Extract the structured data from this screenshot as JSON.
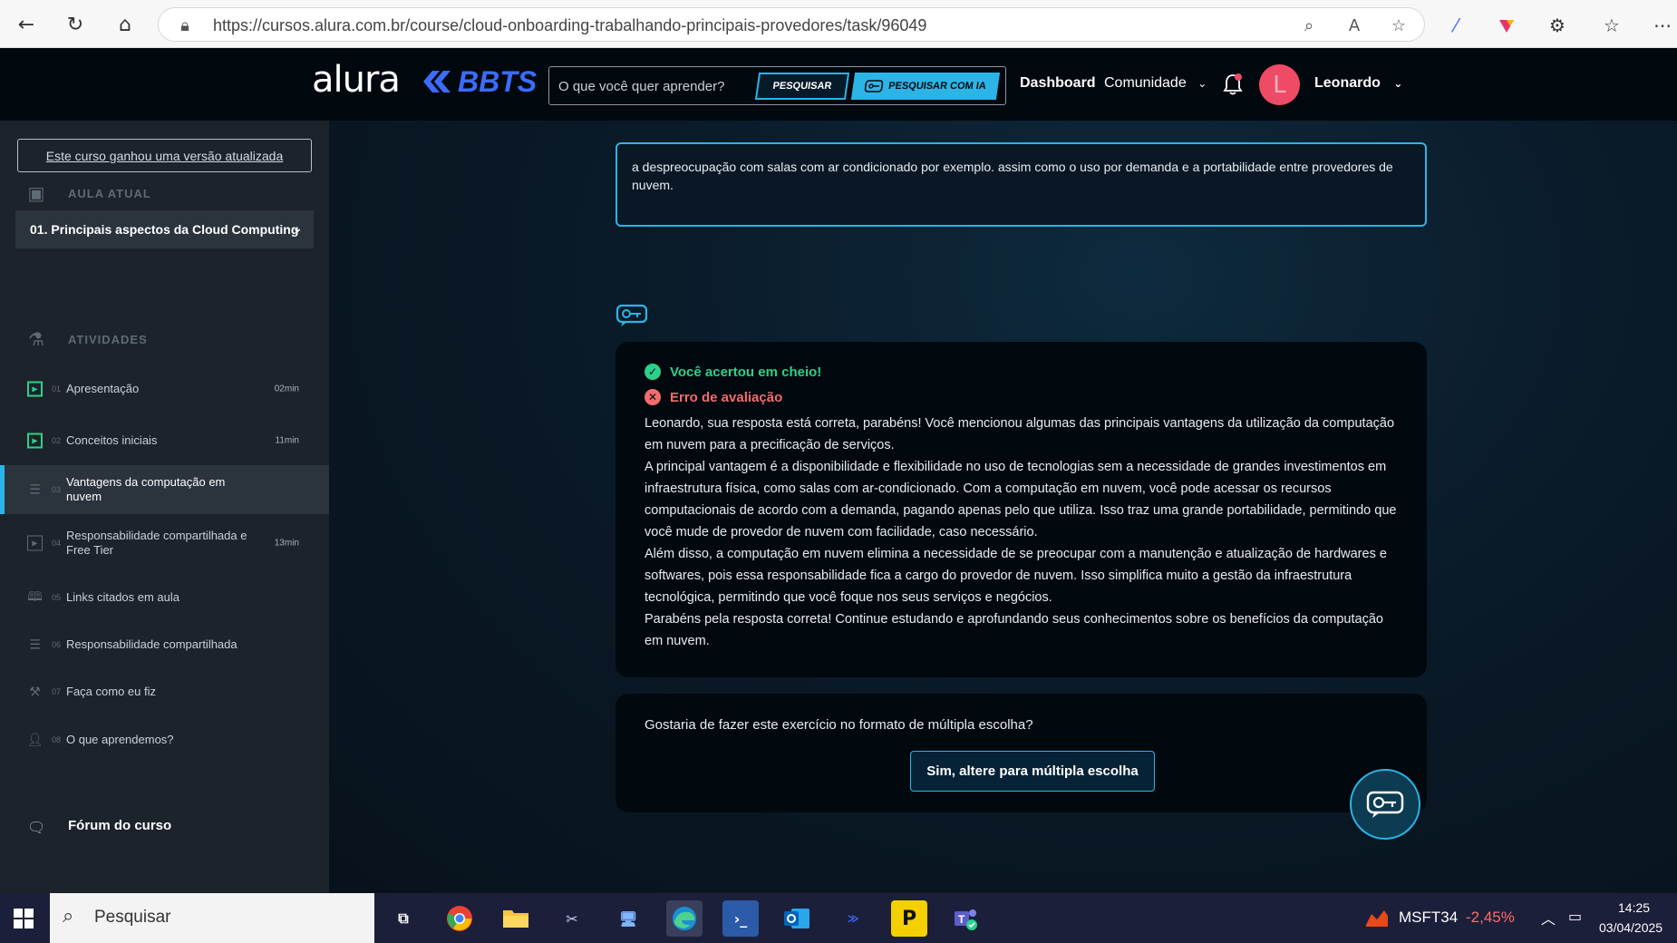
{
  "browser": {
    "url": "https://cursos.alura.com.br/course/cloud-onboarding-trabalhando-principais-provedores/task/96049"
  },
  "header": {
    "logo": "alura",
    "partner_logo": "BBTS",
    "search_placeholder": "O que você quer aprender?",
    "search_button": "PESQUISAR",
    "search_ai_button": "PESQUISAR COM IA",
    "nav": {
      "dashboard": "Dashboard",
      "community": "Comunidade"
    },
    "avatar_letter": "L",
    "user_name": "Leonardo"
  },
  "sidebar": {
    "updated_notice": "Este curso ganhou uma versão atualizada",
    "current_lesson_label": "AULA ATUAL",
    "current_lesson": "01. Principais aspectos da Cloud Computing",
    "activities_label": "ATIVIDADES",
    "activities": [
      {
        "num": "01",
        "title": "Apresentação",
        "time": "02min",
        "icon": "video-icon"
      },
      {
        "num": "02",
        "title": "Conceitos iniciais",
        "time": "11min",
        "icon": "video-icon"
      },
      {
        "num": "03",
        "title": "Vantagens da computação em nuvem",
        "time": "",
        "icon": "list-icon"
      },
      {
        "num": "04",
        "title": "Responsabilidade compartilhada e Free Tier",
        "time": "13min",
        "icon": "video-icon"
      },
      {
        "num": "05",
        "title": "Links citados em aula",
        "time": "",
        "icon": "book-icon"
      },
      {
        "num": "06",
        "title": "Responsabilidade compartilhada",
        "time": "",
        "icon": "list-icon"
      },
      {
        "num": "07",
        "title": "Faça como eu fiz",
        "time": "",
        "icon": "project-icon"
      },
      {
        "num": "08",
        "title": "O que aprendemos?",
        "time": "",
        "icon": "user-check-icon"
      }
    ],
    "forum": "Fórum do curso"
  },
  "main": {
    "answer_text": "a despreocupação com salas com ar condicionado por exemplo. assim como o uso por  demanda e a portabilidade entre provedores de nuvem.",
    "feedback": {
      "success": "Você acertou em cheio!",
      "error": "Erro de avaliação",
      "paragraphs": [
        "Leonardo, sua resposta está correta, parabéns! Você mencionou algumas das principais vantagens da utilização da computação em nuvem para a precificação de serviços.",
        "A principal vantagem é a disponibilidade e flexibilidade no uso de tecnologias sem a necessidade de grandes investimentos em infraestrutura física, como salas com ar-condicionado. Com a computação em nuvem, você pode acessar os recursos computacionais de acordo com a demanda, pagando apenas pelo que utiliza. Isso traz uma grande portabilidade, permitindo que você mude de provedor de nuvem com facilidade, caso necessário.",
        "Além disso, a computação em nuvem elimina a necessidade de se preocupar com a manutenção e atualização de hardwares e softwares, pois essa responsabilidade fica a cargo do provedor de nuvem. Isso simplifica muito a gestão da infraestrutura tecnológica, permitindo que você foque nos seus serviços e negócios.",
        "Parabéns pela resposta correta! Continue estudando e aprofundando seus conhecimentos sobre os benefícios da computação em nuvem."
      ]
    },
    "multiple_choice": {
      "question": "Gostaria de fazer este exercício no formato de múltipla escolha?",
      "button": "Sim, altere para múltipla escolha"
    }
  },
  "taskbar": {
    "search": "Pesquisar",
    "stock_symbol": "MSFT34",
    "stock_change": "-2,45%",
    "time": "14:25",
    "date": "03/04/2025"
  },
  "colors": {
    "accent": "#2bb5e6",
    "success": "#2bd18a",
    "error": "#f26d6d",
    "avatar": "#ef4b66"
  }
}
